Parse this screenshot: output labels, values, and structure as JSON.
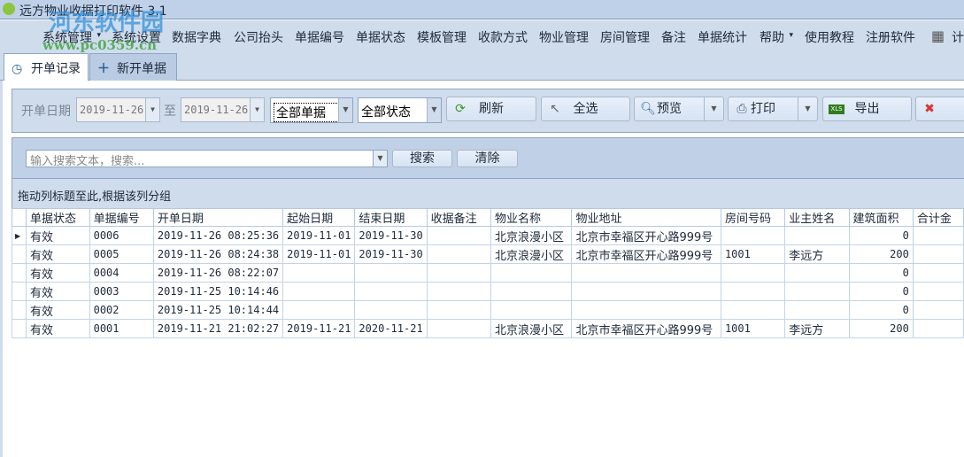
{
  "window": {
    "title": "远方物业收据打印软件 3.1"
  },
  "watermark": {
    "text": "河东软件园",
    "url": "www.pc0359.cn"
  },
  "menu": [
    "系统管理",
    "系统设置",
    "数据字典",
    "公司抬头",
    "单据编号",
    "单据状态",
    "模板管理",
    "收款方式",
    "物业管理",
    "房间管理",
    "备注",
    "单据统计",
    "帮助",
    "使用教程",
    "注册软件",
    "计"
  ],
  "tabs": {
    "records": "开单记录",
    "new": "新开单据"
  },
  "toolbar": {
    "date_label": "开单日期",
    "date_from": "2019-11-26",
    "to_label": "至",
    "date_to": "2019-11-26",
    "type_filter": "全部单据",
    "status_filter": "全部状态",
    "refresh": "刷新",
    "select_all": "全选",
    "preview": "预览",
    "print": "打印",
    "export": "导出",
    "delete": "删"
  },
  "search": {
    "placeholder": "输入搜索文本，搜索...",
    "search": "搜索",
    "clear": "清除",
    "group_hint": "拖动列标题至此,根据该列分组"
  },
  "grid": {
    "columns": [
      "单据状态",
      "单据编号",
      "开单日期",
      "起始日期",
      "结束日期",
      "收据备注",
      "物业名称",
      "物业地址",
      "房间号码",
      "业主姓名",
      "建筑面积",
      "合计金"
    ],
    "rows": [
      [
        "有效",
        "0006",
        "2019-11-26 08:25:36",
        "2019-11-01",
        "2019-11-30",
        "",
        "北京浪漫小区",
        "北京市幸福区开心路999号",
        "",
        "",
        "0",
        ""
      ],
      [
        "有效",
        "0005",
        "2019-11-26 08:24:38",
        "2019-11-01",
        "2019-11-30",
        "",
        "北京浪漫小区",
        "北京市幸福区开心路999号",
        "1001",
        "李远方",
        "200",
        ""
      ],
      [
        "有效",
        "0004",
        "2019-11-26 08:22:07",
        "",
        "",
        "",
        "",
        "",
        "",
        "",
        "0",
        ""
      ],
      [
        "有效",
        "0003",
        "2019-11-25 10:14:46",
        "",
        "",
        "",
        "",
        "",
        "",
        "",
        "0",
        ""
      ],
      [
        "有效",
        "0002",
        "2019-11-25 10:14:44",
        "",
        "",
        "",
        "",
        "",
        "",
        "",
        "0",
        ""
      ],
      [
        "有效",
        "0001",
        "2019-11-21 21:02:27",
        "2019-11-21",
        "2020-11-21",
        "",
        "北京浪漫小区",
        "北京市幸福区开心路999号",
        "1001",
        "李远方",
        "200",
        ""
      ]
    ]
  }
}
